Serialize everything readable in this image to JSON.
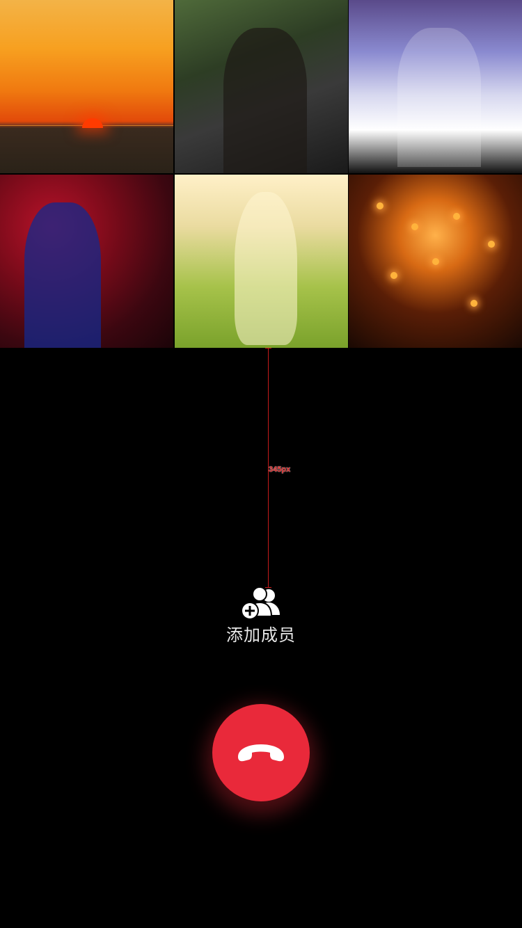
{
  "video_tiles": [
    {
      "name": "sunset-sea"
    },
    {
      "name": "blonde-woman-leather-jacket"
    },
    {
      "name": "young-man-with-crown"
    },
    {
      "name": "man-in-blue-suit-with-roses"
    },
    {
      "name": "long-hair-girl-in-field"
    },
    {
      "name": "sky-lanterns-at-night"
    }
  ],
  "measurement": {
    "label": "345px",
    "color": "#c51a1a"
  },
  "add_member": {
    "label": "添加成员",
    "icon": "add-user-icon"
  },
  "hangup": {
    "icon": "end-call-icon",
    "color": "#e9293a"
  }
}
